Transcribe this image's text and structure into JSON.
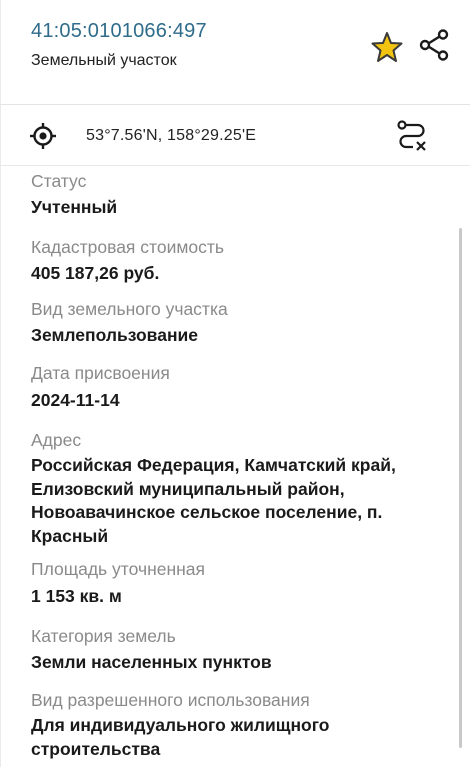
{
  "header": {
    "cadastral_number": "41:05:0101066:497",
    "object_type": "Земельный участок",
    "favorite_icon": "star-icon",
    "share_icon": "share-icon",
    "accent_color": "#2f6b8a",
    "star_color": "#f2c40f"
  },
  "location": {
    "coordinates": "53°7.56'N, 158°29.25'E",
    "target_icon": "crosshair-icon",
    "route_icon": "route-icon"
  },
  "fields": [
    {
      "label": "Статус",
      "value": "Учтенный"
    },
    {
      "label": "Кадастровая стоимость",
      "value": "405 187,26 руб."
    },
    {
      "label": "Вид земельного участка",
      "value": "Землепользование"
    },
    {
      "label": "Дата присвоения",
      "value": "2024-11-14"
    },
    {
      "label": "Адрес",
      "value": "Российская Федерация, Камчатский край, Елизовский муниципальный район, Новоавачинское сельское поселение, п. Красный"
    },
    {
      "label": "Площадь уточненная",
      "value": "1 153 кв. м"
    },
    {
      "label": "Категория земель",
      "value": "Земли населенных пунктов"
    },
    {
      "label": "Вид разрешенного использования",
      "value": "Для индивидуального жилищного строительства"
    }
  ]
}
